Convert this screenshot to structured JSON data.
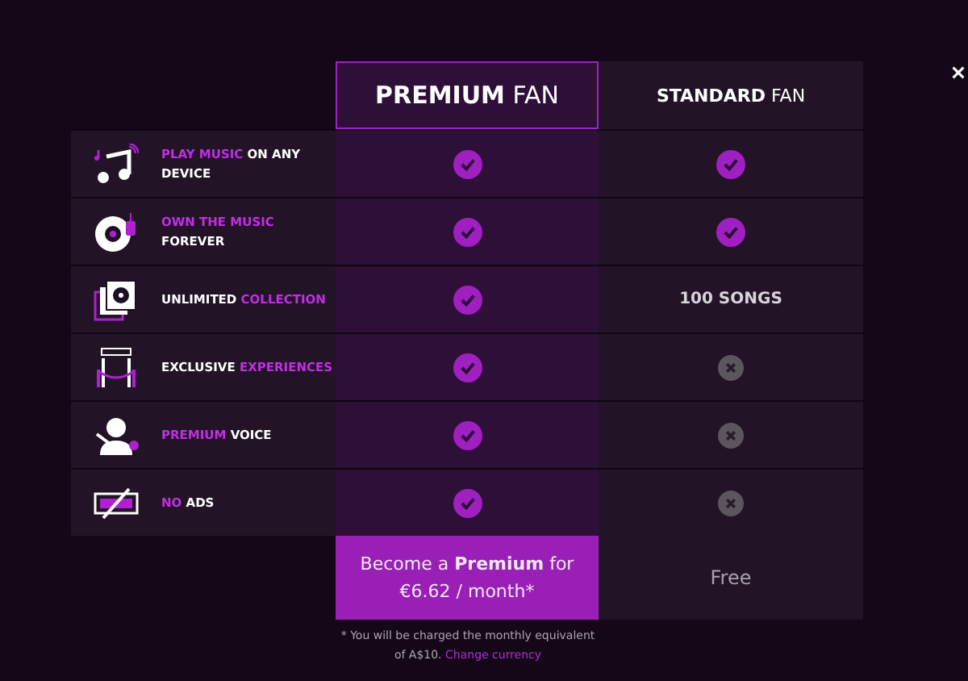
{
  "plans": [
    {
      "title": "**PREMIUM** FAN",
      "selected": true
    },
    {
      "title": "**STANDARD** FAN",
      "selected": false
    }
  ],
  "features": [
    {
      "label": [
        {
          "text": "PLAY MUSIC",
          "highlight": true
        },
        {
          "text": " ON ANY DEVICE",
          "highlight": false
        }
      ],
      "premium": {
        "kind": "check"
      },
      "standard": {
        "kind": "check"
      }
    },
    {
      "label": [
        {
          "text": "OWN THE MUSIC",
          "highlight": true
        },
        {
          "text": " FOREVER",
          "highlight": false
        }
      ],
      "premium": {
        "kind": "check"
      },
      "standard": {
        "kind": "check"
      }
    },
    {
      "label": [
        {
          "text": "UNLIMITED ",
          "highlight": false
        },
        {
          "text": "COLLECTION",
          "highlight": true
        }
      ],
      "premium": {
        "kind": "check"
      },
      "standard": {
        "kind": "text",
        "text": "100 SONGS"
      }
    },
    {
      "label": [
        {
          "text": "EXCLUSIVE ",
          "highlight": false
        },
        {
          "text": "EXPERIENCES",
          "highlight": true
        }
      ],
      "premium": {
        "kind": "check"
      },
      "standard": {
        "kind": "cross"
      }
    },
    {
      "label": [
        {
          "text": "PREMIUM",
          "highlight": true
        },
        {
          "text": " VOICE",
          "highlight": false
        }
      ],
      "premium": {
        "kind": "check"
      },
      "standard": {
        "kind": "cross"
      }
    },
    {
      "label": [
        {
          "text": "NO",
          "highlight": true
        },
        {
          "text": " ADS",
          "highlight": false
        }
      ],
      "premium": {
        "kind": "check"
      },
      "standard": {
        "kind": "cross"
      }
    }
  ],
  "premium_button": "Become a **Premium** for €6.62 / month*",
  "standard_price": "Free",
  "footnote": "* You will be charged the monthly equivalent of A$10.",
  "footnote_link": "Change currency"
}
